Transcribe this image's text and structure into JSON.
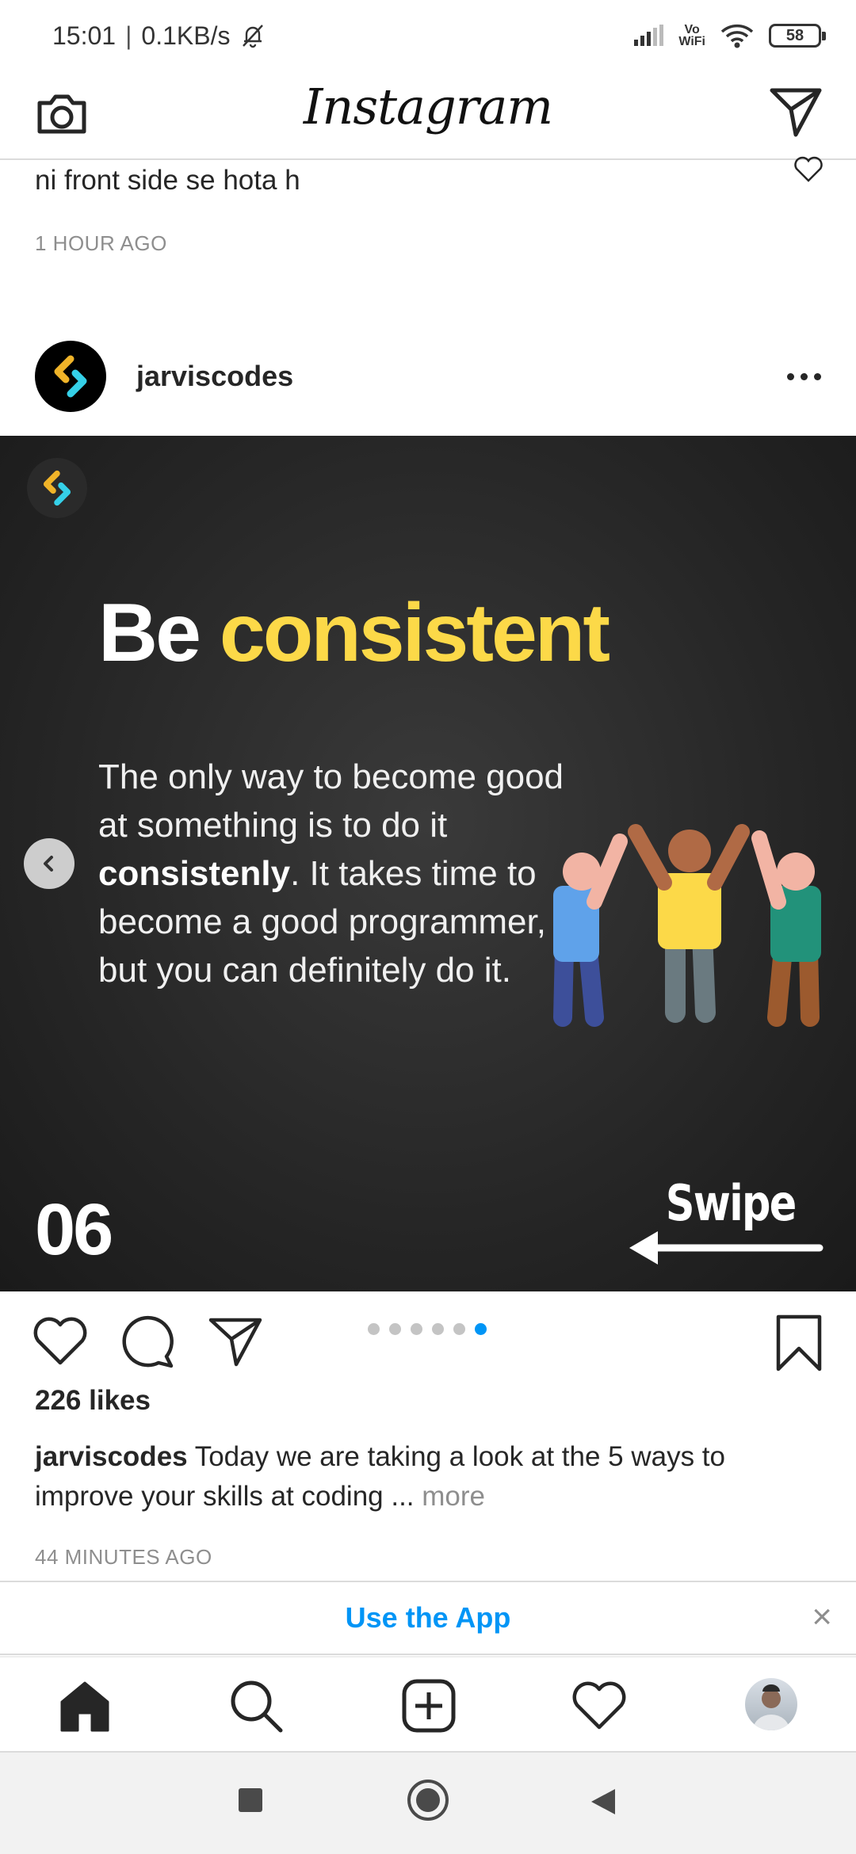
{
  "status_bar": {
    "time": "15:01",
    "speed": "0.1KB/s",
    "vowifi_top": "Vo",
    "vowifi_bottom": "WiFi",
    "battery": "58"
  },
  "header": {
    "logo": "Instagram"
  },
  "previous_post": {
    "caption_fragment": "ni front side se hota h",
    "time": "1 HOUR AGO"
  },
  "post": {
    "username": "jarviscodes",
    "image": {
      "headline_word1": "Be",
      "headline_word2": "consistent",
      "body_pre": "The only way to become good at something is to do it ",
      "body_bold": "consistenly",
      "body_post": ". It takes time to become a good programmer, but you can definitely do it.",
      "slide_number": "06",
      "swipe": "Swipe"
    },
    "carousel": {
      "count": 6,
      "active_index": 5
    },
    "likes": "226 likes",
    "caption_user": "jarviscodes",
    "caption_text": " Today we are taking a look at the 5 ways to improve your skills at coding ...",
    "caption_more": " more",
    "time": "44 MINUTES AGO"
  },
  "banner": {
    "text": "Use the App",
    "close": "×"
  },
  "colors": {
    "accent": "#0095f6",
    "highlight": "#fcd948",
    "text": "#262626",
    "muted": "#8e8e8e"
  },
  "icons": [
    "camera-icon",
    "direct-message-icon",
    "heart-icon",
    "comment-icon",
    "share-icon",
    "bookmark-icon",
    "home-icon",
    "search-icon",
    "new-post-icon",
    "activity-icon",
    "profile-avatar",
    "stop-icon",
    "home-circle-icon",
    "back-icon"
  ]
}
